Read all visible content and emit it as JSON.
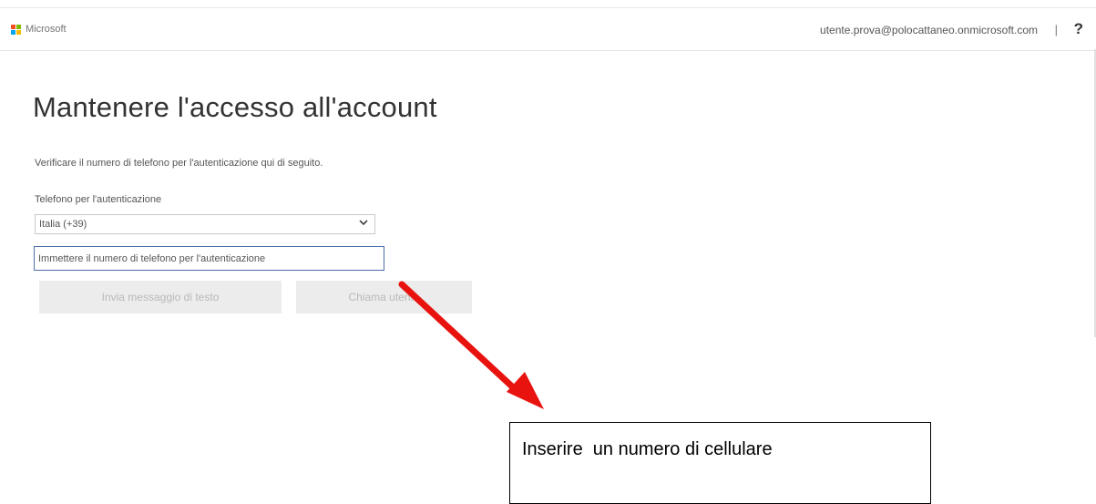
{
  "header": {
    "brand": "Microsoft",
    "user_email": "utente.prova@polocattaneo.onmicrosoft.com",
    "separator": "|",
    "help": "?"
  },
  "page": {
    "title": "Mantenere l'accesso all'account",
    "description": "Verificare il numero di telefono per l'autenticazione qui di seguito.",
    "field_label": "Telefono per l'autenticazione",
    "country_value": "Italia (+39)",
    "phone_placeholder": "Immettere il numero di telefono per l'autenticazione",
    "phone_value": "",
    "sms_button": "Invia messaggio di testo",
    "call_button": "Chiama utente"
  },
  "annotation": {
    "callout_text": "Inserire  un numero di cellulare",
    "arrow_color": "#e8130f"
  },
  "colors": {
    "logo_red": "#f25022",
    "logo_green": "#7fba00",
    "logo_blue": "#00a4ef",
    "logo_yellow": "#ffb900",
    "input_border": "#4a6ea8"
  }
}
